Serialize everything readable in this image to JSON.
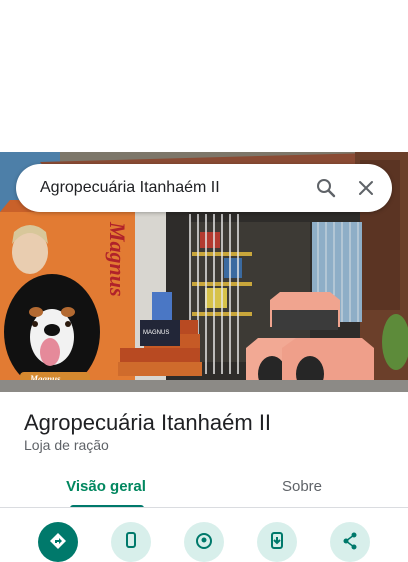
{
  "search": {
    "query": "Agropecuária Itanhaém II",
    "search_icon": "search-icon",
    "close_icon": "close-icon"
  },
  "hero": {
    "sign_brand": "Magnus",
    "sign_brand_small": "Magnus",
    "bag_brand": "MAGNUS"
  },
  "place": {
    "title": "Agropecuária Itanhaém II",
    "category": "Loja de ração"
  },
  "tabs": [
    {
      "label": "Visão geral",
      "selected": true
    },
    {
      "label": "Sobre",
      "selected": false
    }
  ],
  "actions": [
    {
      "icon": "directions-icon",
      "style": "primary"
    },
    {
      "icon": "phone-icon",
      "style": "secondary"
    },
    {
      "icon": "nearby-icon",
      "style": "secondary"
    },
    {
      "icon": "send-to-phone-icon",
      "style": "secondary"
    },
    {
      "icon": "share-icon",
      "style": "secondary"
    }
  ],
  "colors": {
    "accent": "#00796b",
    "tab_selected_text": "#01875f",
    "action_secondary_bg": "#d8efeb"
  }
}
